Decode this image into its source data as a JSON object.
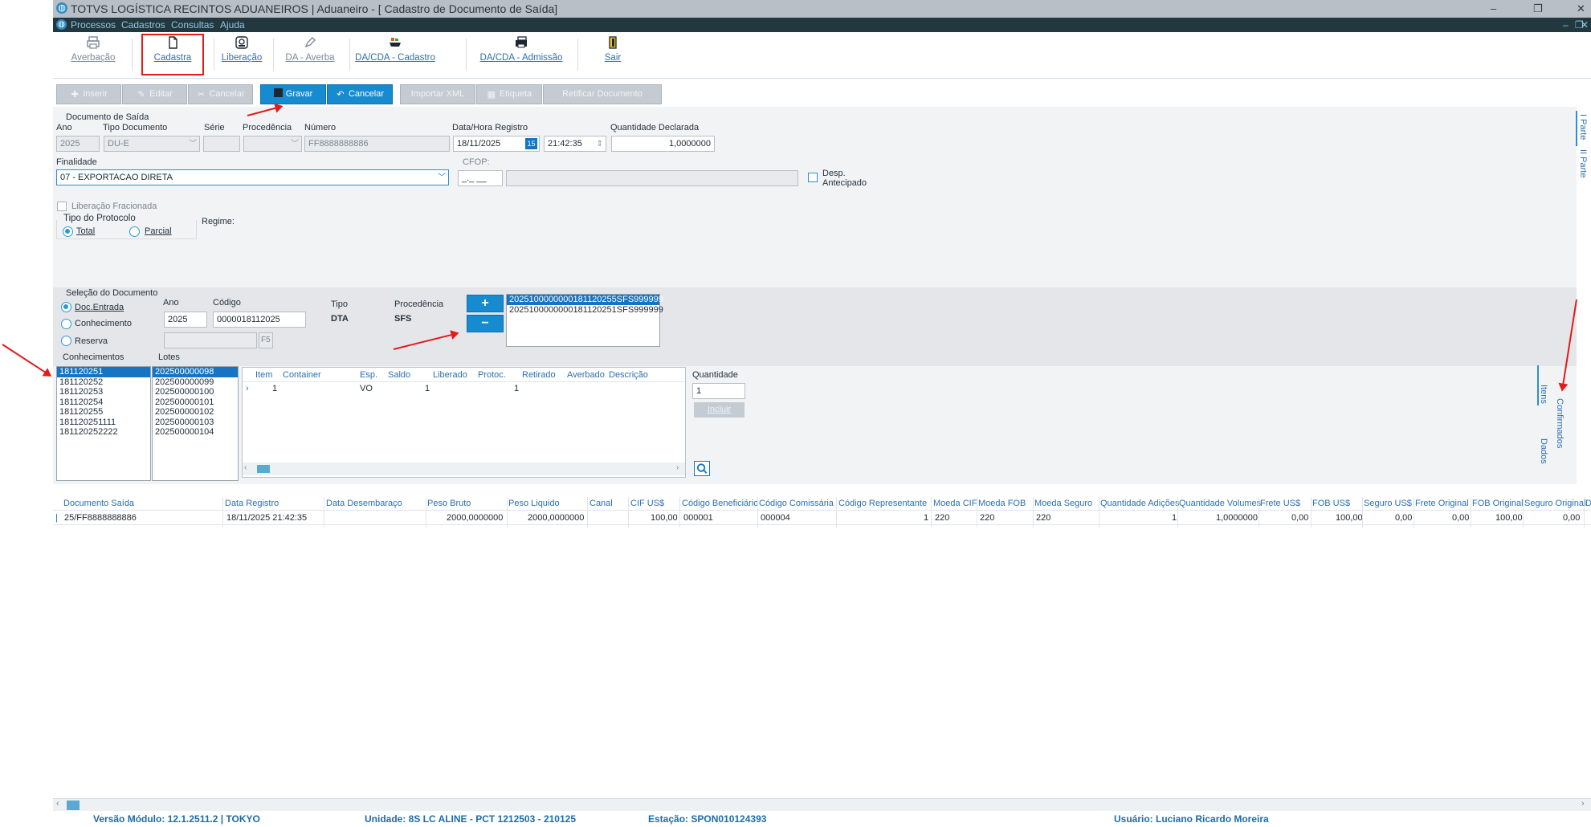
{
  "window": {
    "title": "TOTVS LOGÍSTICA RECINTOS ADUANEIROS | Aduaneiro - [ Cadastro de Documento de Saída]",
    "controls": [
      "–",
      "❐",
      "✕"
    ]
  },
  "menu": {
    "items": [
      "Processos",
      "Cadastros",
      "Consultas",
      "Ajuda"
    ],
    "controls": [
      "–",
      "❐",
      "✕"
    ]
  },
  "toolbar": {
    "items": [
      {
        "label": "Averbação",
        "icon": "printer-icon",
        "enabled": false
      },
      {
        "label": "Cadastra",
        "icon": "document-icon",
        "enabled": true
      },
      {
        "label": "Liberação",
        "icon": "stamp-icon",
        "enabled": true
      },
      {
        "label": "DA - Averba",
        "icon": "pen-icon",
        "enabled": false
      },
      {
        "label": "DA/CDA - Cadastro",
        "icon": "container-ship-icon",
        "enabled": true
      },
      {
        "label": "DA/CDA - Admissão",
        "icon": "printer-stack-icon",
        "enabled": true
      },
      {
        "label": "Sair",
        "icon": "exit-door-icon",
        "enabled": true
      }
    ]
  },
  "actions": {
    "inserir": "Inserir",
    "editar": "Editar",
    "cancelar_disabled": "Cancelar",
    "gravar": "Gravar",
    "cancelar": "Cancelar",
    "importar_xml": "Importar XML",
    "etiqueta": "Etiqueta",
    "retificar": "Retificar Documento"
  },
  "documento": {
    "section_title": "Documento de Saída",
    "ano_label": "Ano",
    "ano_value": "2025",
    "tipo_label": "Tipo Documento",
    "tipo_value": "DU-E",
    "serie_label": "Série",
    "serie_value": "",
    "procedencia_label": "Procedência",
    "procedencia_value": "",
    "numero_label": "Número",
    "numero_value": "FF8888888886",
    "data_hora_label": "Data/Hora Registro",
    "data_value": "18/11/2025",
    "hora_value": "21:42:35",
    "quantidade_label": "Quantidade Declarada",
    "quantidade_value": "1,0000000",
    "finalidade_label": "Finalidade",
    "finalidade_value": "07 - EXPORTACAO DIRETA",
    "cfop_label": "CFOP:",
    "cfop_value": "_._ __",
    "cfop_desc": "",
    "desp_label_1": "Desp.",
    "desp_label_2": "Antecipado",
    "liberacao_fracionada": "Liberação Fracionada",
    "tipo_protocolo_label": "Tipo do Protocolo",
    "protocolo_total": "Total",
    "protocolo_parcial": "Parcial",
    "regime_label": "Regime:"
  },
  "side_tabs": {
    "parte1": "I Parte",
    "parte2": "II Parte"
  },
  "selecao": {
    "title": "Seleção do Documento",
    "options": [
      "Doc.Entrada",
      "Conhecimento",
      "Reserva"
    ],
    "ano_label": "Ano",
    "ano_value": "2025",
    "codigo_label": "Código",
    "codigo_value": "0000018112025",
    "f5": "F5",
    "tipo_label": "Tipo",
    "tipo_value": "DTA",
    "procedencia_label": "Procedência",
    "procedencia_value": "SFS",
    "add_symbol": "+",
    "remove_symbol": "−",
    "documents": [
      "2025100000000181120255SFS999999",
      "2025100000000181120251SFS999999"
    ]
  },
  "conhecimentos": {
    "label": "Conhecimentos",
    "items": [
      "181120251",
      "181120252",
      "181120253",
      "181120254",
      "181120255",
      "181120251111",
      "181120252222"
    ]
  },
  "lotes": {
    "label": "Lotes",
    "items": [
      "202500000098",
      "202500000099",
      "202500000100",
      "202500000101",
      "202500000102",
      "202500000103",
      "202500000104"
    ]
  },
  "items_grid": {
    "headers": [
      "Item",
      "Container",
      "Esp.",
      "Saldo",
      "Liberado",
      "Protoc.",
      "Retirado",
      "Averbado",
      "Descrição"
    ],
    "rows": [
      {
        "item": "1",
        "container": "",
        "esp": "VO",
        "saldo": "1",
        "liberado": "",
        "protoc": "1",
        "retirado": "",
        "averbado": "",
        "descricao": ""
      }
    ]
  },
  "quantidade": {
    "label": "Quantidade",
    "value": "1",
    "incluir": "Incluir"
  },
  "vertical_tabs": {
    "itens": "Itens",
    "dados": "Dados",
    "confirmados": "Confirmados"
  },
  "bottom_grid": {
    "headers": [
      "Documento Saída",
      "Data Registro",
      "Data  Desembaraço",
      "Peso Bruto",
      "Peso Liquido",
      "Canal",
      "CIF US$",
      "Código Beneficiário",
      "Código Comissária",
      "Código Representante",
      "Moeda CIF",
      "Moeda FOB",
      "Moeda Seguro",
      "Quantidade Adições",
      "Quantidade Volumes",
      "Frete US$",
      "FOB US$",
      "Seguro US$",
      "Frete Original",
      "FOB Original",
      "Seguro Original",
      "D"
    ],
    "row": [
      "25/FF8888888886",
      "18/11/2025 21:42:35",
      "",
      "2000,0000000",
      "2000,0000000",
      "",
      "100,00",
      "000001",
      "000004",
      "1",
      "220",
      "220",
      "220",
      "1",
      "1,0000000",
      "0,00",
      "100,00",
      "0,00",
      "0,00",
      "100,00",
      "0,00",
      ""
    ]
  },
  "status": {
    "versao": "Versão Módulo:  12.1.2511.2  |  TOKYO",
    "unidade": "Unidade: 8S LC ALINE - PCT 1212503 - 210125",
    "estacao": "Estação: SPON010124393",
    "usuario": "Usuário: Luciano Ricardo Moreira"
  },
  "colors": {
    "accent": "#168bd0",
    "menubar": "#23373f",
    "annotation": "#e21b1b"
  }
}
